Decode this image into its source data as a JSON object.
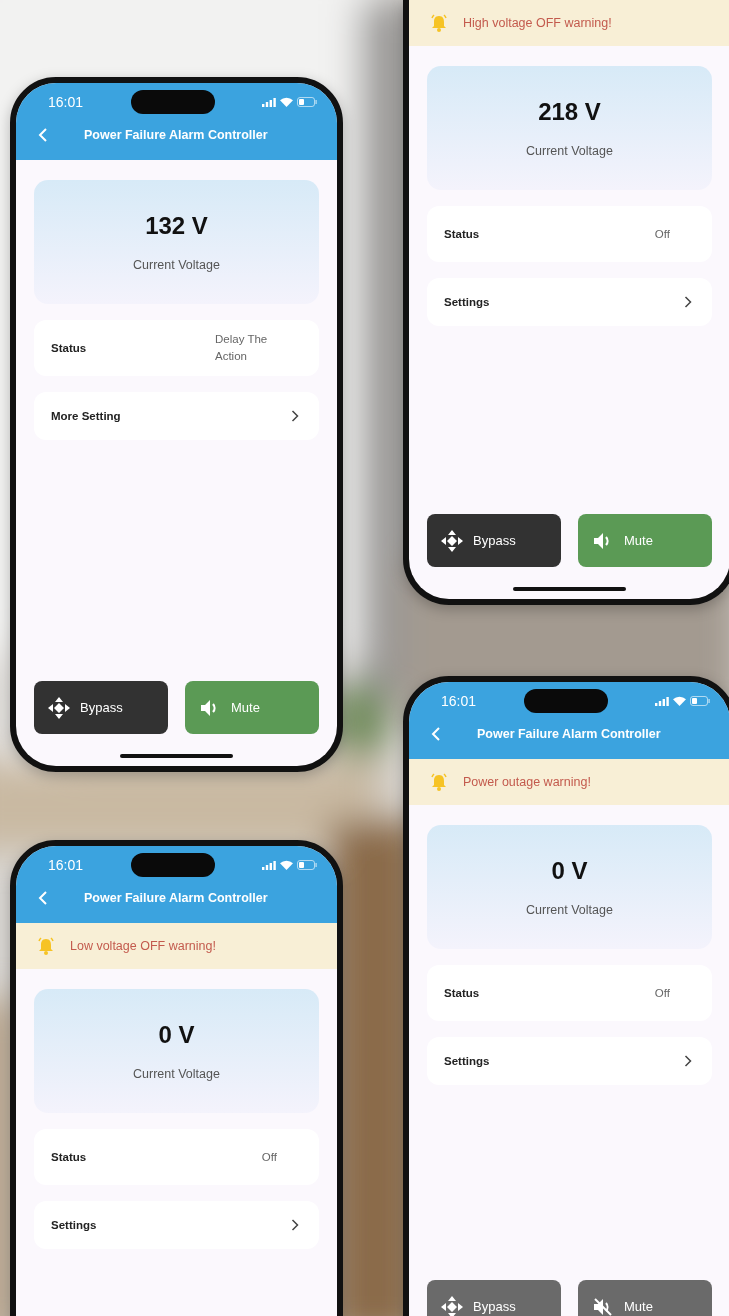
{
  "phones": [
    {
      "time": "16:01",
      "title": "Power Failure Alarm Controller",
      "voltage": "132 V",
      "voltage_label": "Current Voltage",
      "rows": [
        {
          "kind": "value",
          "label": "Status",
          "value": "Delay The Action"
        },
        {
          "kind": "link",
          "label": "More Setting"
        }
      ],
      "buttons": [
        {
          "kind": "bypass",
          "label": "Bypass",
          "disabled": false
        },
        {
          "kind": "mute",
          "label": "Mute",
          "disabled": false,
          "muted": false
        }
      ]
    },
    {
      "warning": "High voltage OFF warning!",
      "voltage": "218 V",
      "voltage_label": "Current Voltage",
      "rows": [
        {
          "kind": "value",
          "label": "Status",
          "value": "Off"
        },
        {
          "kind": "link",
          "label": "Settings"
        }
      ],
      "buttons": [
        {
          "kind": "bypass",
          "label": "Bypass",
          "disabled": false
        },
        {
          "kind": "mute",
          "label": "Mute",
          "disabled": false,
          "muted": false
        }
      ]
    },
    {
      "time": "16:01",
      "title": "Power Failure Alarm Controller",
      "warning": "Low voltage OFF warning!",
      "voltage": "0 V",
      "voltage_label": "Current Voltage",
      "rows": [
        {
          "kind": "value",
          "label": "Status",
          "value": "Off"
        },
        {
          "kind": "link",
          "label": "Settings"
        }
      ]
    },
    {
      "time": "16:01",
      "title": "Power Failure Alarm Controller",
      "warning": "Power outage warning!",
      "voltage": "0 V",
      "voltage_label": "Current Voltage",
      "rows": [
        {
          "kind": "value",
          "label": "Status",
          "value": "Off"
        },
        {
          "kind": "link",
          "label": "Settings"
        }
      ],
      "buttons": [
        {
          "kind": "bypass",
          "label": "Bypass",
          "disabled": true
        },
        {
          "kind": "mute",
          "label": "Mute",
          "disabled": true,
          "muted": true
        }
      ]
    }
  ]
}
